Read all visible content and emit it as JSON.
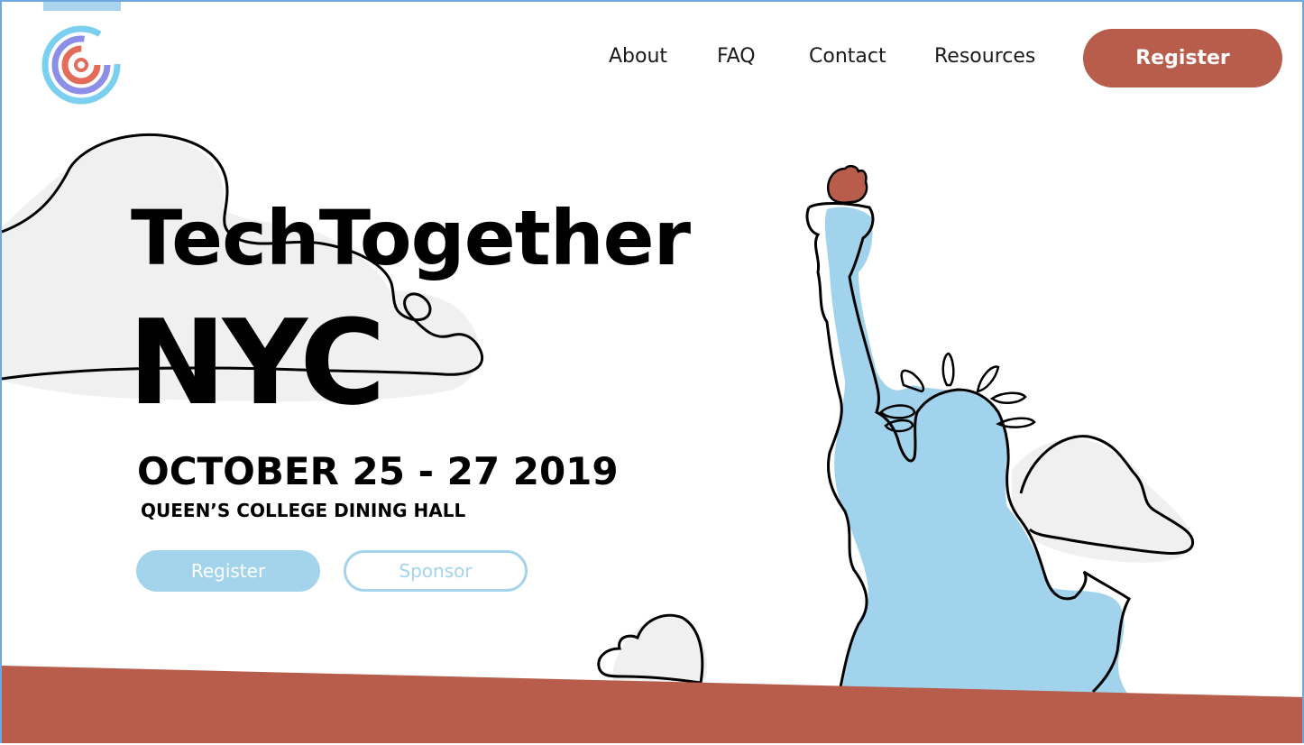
{
  "nav": {
    "links": [
      "About",
      "FAQ",
      "Contact",
      "Resources"
    ],
    "register_label": "Register"
  },
  "hero": {
    "title": "TechTogether",
    "city": "NYC",
    "date": "OCTOBER 25 - 27 2019",
    "venue": "QUEEN’S COLLEGE DINING HALL",
    "register_label": "Register",
    "sponsor_label": "Sponsor"
  },
  "colors": {
    "accent": "#b85c4b",
    "light_blue": "#a4d3ec",
    "cloud_gray": "#f0f0f0",
    "frame_border": "#6ea8dc"
  },
  "icons": {
    "logo": "concentric-circle-logo-icon"
  }
}
